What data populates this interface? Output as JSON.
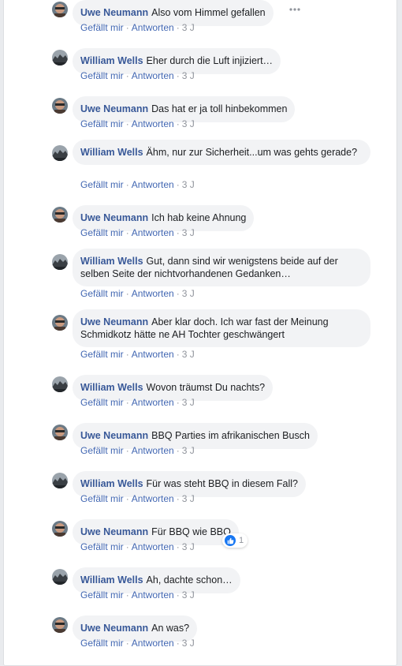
{
  "comments": [
    {
      "author": "Uwe Neumann",
      "text": "Also vom Himmel gefallen",
      "like": "Gefällt mir",
      "reply": "Antworten",
      "time": "3 J"
    },
    {
      "author": "William Wells",
      "text": "Eher durch die Luft injiziert…",
      "like": "Gefällt mir",
      "reply": "Antworten",
      "time": "3 J"
    },
    {
      "author": "Uwe Neumann",
      "text": "Das hat er ja toll hinbekommen",
      "like": "Gefällt mir",
      "reply": "Antworten",
      "time": "3 J"
    },
    {
      "author": "William Wells",
      "text": "Ähm, nur zur Sicherheit...um was gehts gerade?",
      "like": "Gefällt mir",
      "reply": "Antworten",
      "time": "3 J"
    },
    {
      "author": "Uwe Neumann",
      "text": "Ich hab keine Ahnung",
      "like": "Gefällt mir",
      "reply": "Antworten",
      "time": "3 J"
    },
    {
      "author": "William Wells",
      "text": "Gut, dann sind wir wenigstens beide auf der selben Seite der nichtvorhandenen Gedanken…",
      "like": "Gefällt mir",
      "reply": "Antworten",
      "time": "3 J"
    },
    {
      "author": "Uwe Neumann",
      "text": "Aber klar doch. Ich war fast der Meinung Schmidkotz hätte ne AH Tochter geschwängert",
      "like": "Gefällt mir",
      "reply": "Antworten",
      "time": "3 J"
    },
    {
      "author": "William Wells",
      "text": "Wovon träumst Du nachts?",
      "like": "Gefällt mir",
      "reply": "Antworten",
      "time": "3 J"
    },
    {
      "author": "Uwe Neumann",
      "text": "BBQ Parties im afrikanischen Busch",
      "like": "Gefällt mir",
      "reply": "Antworten",
      "time": "3 J"
    },
    {
      "author": "William Wells",
      "text": "Für was steht BBQ in diesem Fall?",
      "like": "Gefällt mir",
      "reply": "Antworten",
      "time": "3 J"
    },
    {
      "author": "Uwe Neumann",
      "text": "Für BBQ wie BBQ",
      "like": "Gefällt mir",
      "reply": "Antworten",
      "time": "3 J",
      "reaction_count": "1"
    },
    {
      "author": "William Wells",
      "text": "Ah, dachte schon…",
      "like": "Gefällt mir",
      "reply": "Antworten",
      "time": "3 J"
    },
    {
      "author": "Uwe Neumann",
      "text": "An was?",
      "like": "Gefällt mir",
      "reply": "Antworten",
      "time": "3 J"
    }
  ],
  "icons": {
    "more": "more-options-icon",
    "like_reaction": "thumbs-up-icon"
  },
  "colors": {
    "author": "#385898",
    "link": "#4267b2",
    "bubble": "#f2f3f5",
    "muted": "#90949c",
    "like_blue": "#1877f2"
  }
}
